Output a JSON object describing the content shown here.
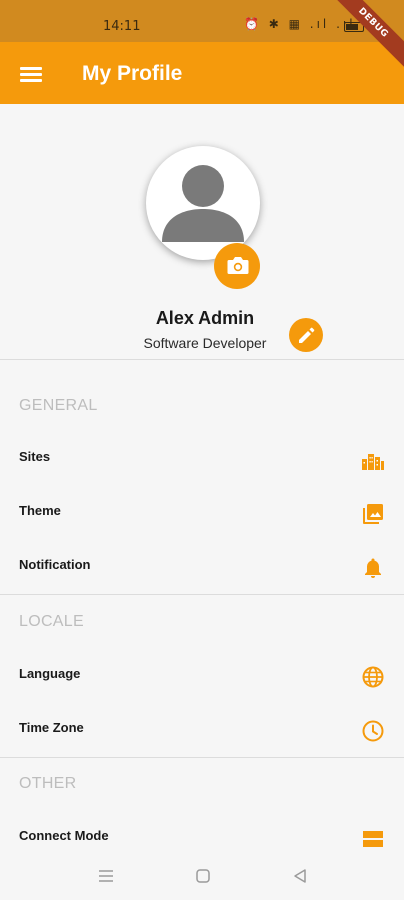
{
  "status_bar": {
    "time": "14:11",
    "icons_text": "⏰ ✱ ▦ .ıl .ıl",
    "debug_label": "DEBUG"
  },
  "app_bar": {
    "title": "My Profile",
    "menu_icon": "menu-icon",
    "color": "#f59a0c"
  },
  "profile": {
    "name": "Alex Admin",
    "role": "Software Developer",
    "avatar_icon": "person-icon",
    "camera_icon": "camera-icon",
    "edit_icon": "pencil-icon"
  },
  "sections": {
    "general": {
      "header": "GENERAL",
      "items": [
        {
          "label": "Sites",
          "icon": "buildings-icon"
        },
        {
          "label": "Theme",
          "icon": "photo-library-icon"
        },
        {
          "label": "Notification",
          "icon": "bell-icon"
        }
      ]
    },
    "locale": {
      "header": "LOCALE",
      "items": [
        {
          "label": "Language",
          "icon": "globe-icon"
        },
        {
          "label": "Time Zone",
          "icon": "clock-icon"
        }
      ]
    },
    "other": {
      "header": "OTHER",
      "items": [
        {
          "label": "Connect Mode",
          "icon": "storage-icon"
        }
      ]
    }
  },
  "nav_bar": {
    "icons": [
      "menu-lines-icon",
      "home-square-icon",
      "back-triangle-icon"
    ]
  }
}
